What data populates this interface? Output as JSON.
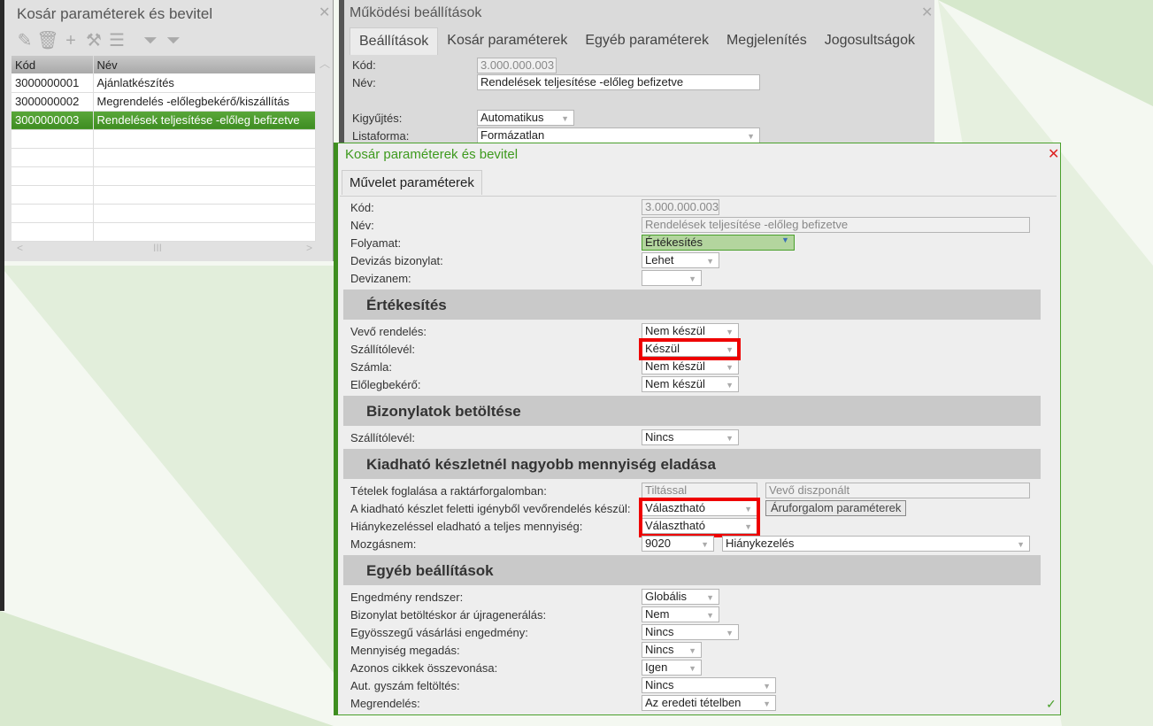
{
  "left_window": {
    "title": "Kosár paraméterek és bevitel",
    "toolbar": [
      "edit-icon",
      "delete-icon",
      "add-icon",
      "tools-icon",
      "menu-icon",
      "filter-icon",
      "clear-filter-icon"
    ],
    "columns": [
      "Kód",
      "Név"
    ],
    "rows": [
      {
        "code": "3000000001",
        "name": "Ajánlatkészítés"
      },
      {
        "code": "3000000002",
        "name": "Megrendelés -előlegbekérő/kiszállítás"
      },
      {
        "code": "3000000003",
        "name": "Rendelések teljesítése -előleg befizetve"
      }
    ],
    "selected_row": 2
  },
  "back_window": {
    "title": "Működési beállítások",
    "tabs": [
      "Beállítások",
      "Kosár paraméterek",
      "Egyéb paraméterek",
      "Megjelenítés",
      "Jogosultságok"
    ],
    "fields": {
      "kod_label": "Kód:",
      "kod": "3.000.000.003",
      "nev_label": "Név:",
      "nev": "Rendelések teljesítése -előleg befizetve",
      "kigyujtes_label": "Kigyűjtés:",
      "kigyujtes": "Automatikus",
      "listaforma_label": "Listaforma:",
      "listaforma": "Formázatlan"
    }
  },
  "main_window": {
    "title": "Kosár paraméterek és bevitel",
    "tab": "Művelet paraméterek",
    "top": [
      {
        "label": "Kód:",
        "value": "3.000.000.003"
      },
      {
        "label": "Név:",
        "value": "Rendelések teljesítése -előleg befizetve"
      },
      {
        "label": "Folyamat:",
        "value": "Értékesítés"
      },
      {
        "label": "Devizás bizonylat:",
        "value": "Lehet"
      },
      {
        "label": "Devizanem:",
        "value": ""
      }
    ],
    "sec1": {
      "title": "Értékesítés",
      "rows": [
        {
          "label": "Vevő rendelés:",
          "value": "Nem készül"
        },
        {
          "label": "Szállítólevél:",
          "value": "Készül"
        },
        {
          "label": "Számla:",
          "value": "Nem készül"
        },
        {
          "label": "Előlegbekérő:",
          "value": "Nem készül"
        }
      ]
    },
    "sec2": {
      "title": "Bizonylatok betöltése",
      "rows": [
        {
          "label": "Szállítólevél:",
          "value": "Nincs"
        }
      ]
    },
    "sec3": {
      "title": "Kiadható készletnél nagyobb mennyiség eladása",
      "rows": [
        {
          "label": "Tételek foglalása a raktárforgalomban:",
          "value": "Tiltással",
          "value2": "Vevő diszponált"
        },
        {
          "label": "A kiadható készlet feletti igényből vevőrendelés készül:",
          "value": "Választható",
          "button": "Áruforgalom paraméterek"
        },
        {
          "label": "Hiánykezeléssel eladható a teljes mennyiség:",
          "value": "Választható"
        },
        {
          "label": "Mozgásnem:",
          "value": "9020",
          "value2": "Hiánykezelés"
        }
      ]
    },
    "sec4": {
      "title": "Egyéb beállítások",
      "rows": [
        {
          "label": "Engedmény rendszer:",
          "value": "Globális"
        },
        {
          "label": "Bizonylat betöltéskor ár újragenerálás:",
          "value": "Nem"
        },
        {
          "label": "Egyösszegű vásárlási engedmény:",
          "value": "Nincs"
        },
        {
          "label": "Mennyiség megadás:",
          "value": "Nincs"
        },
        {
          "label": "Azonos cikkek összevonása:",
          "value": "Igen"
        },
        {
          "label": "Aut. gyszám feltöltés:",
          "value": "Nincs"
        },
        {
          "label": "Megrendelés:",
          "value": "Az eredeti tételben"
        }
      ]
    }
  },
  "colors": {
    "accent": "#4aa02c",
    "highlight": "#e00000"
  }
}
